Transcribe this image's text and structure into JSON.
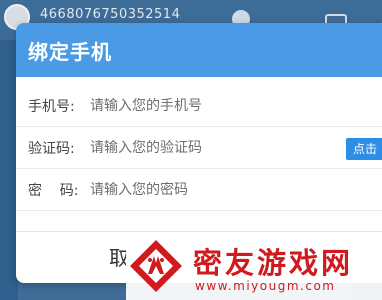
{
  "background": {
    "user_id": "4668076750352514"
  },
  "dialog": {
    "title": "绑定手机",
    "fields": [
      {
        "label": "手机号:",
        "placeholder": "请输入您的手机号"
      },
      {
        "label": "验证码:",
        "placeholder": "请输入您的验证码"
      },
      {
        "label": "密    码:",
        "placeholder": "请输入您的密码"
      }
    ],
    "get_code_button": "点击",
    "cancel_button": "取"
  },
  "watermark": {
    "name": "密友游戏网",
    "url": "www.miyougm.com"
  },
  "colors": {
    "header": "#4a9ae6",
    "code_button": "#2e8ee3",
    "watermark": "#d11a1e"
  }
}
